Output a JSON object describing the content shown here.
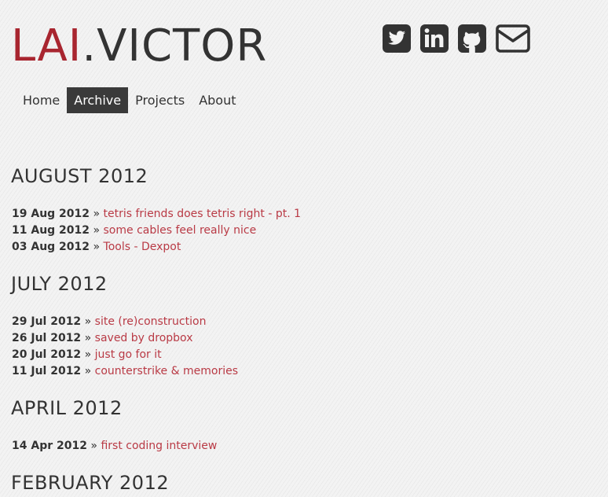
{
  "header": {
    "logo_first": "LAI",
    "logo_rest": ".VICTOR"
  },
  "social": [
    {
      "name": "twitter-icon"
    },
    {
      "name": "linkedin-icon"
    },
    {
      "name": "github-icon"
    },
    {
      "name": "mail-icon"
    }
  ],
  "colors": {
    "accent": "#a8252f",
    "link": "#b93a45",
    "text": "#333333",
    "nav_active_bg": "#3a3a3a"
  },
  "nav": {
    "items": [
      {
        "label": "Home",
        "active": false
      },
      {
        "label": "Archive",
        "active": true
      },
      {
        "label": "Projects",
        "active": false
      },
      {
        "label": "About",
        "active": false
      }
    ]
  },
  "separator": "»",
  "archive": [
    {
      "month": "AUGUST 2012",
      "posts": [
        {
          "date": "19 Aug 2012",
          "title": "tetris friends does tetris right - pt. 1"
        },
        {
          "date": "11 Aug 2012",
          "title": "some cables feel really nice"
        },
        {
          "date": "03 Aug 2012",
          "title": "Tools - Dexpot"
        }
      ]
    },
    {
      "month": "JULY 2012",
      "posts": [
        {
          "date": "29 Jul 2012",
          "title": "site (re)construction"
        },
        {
          "date": "26 Jul 2012",
          "title": "saved by dropbox"
        },
        {
          "date": "20 Jul 2012",
          "title": "just go for it"
        },
        {
          "date": "11 Jul 2012",
          "title": "counterstrike & memories"
        }
      ]
    },
    {
      "month": "APRIL 2012",
      "posts": [
        {
          "date": "14 Apr 2012",
          "title": "first coding interview"
        }
      ]
    },
    {
      "month": "FEBRUARY 2012",
      "posts": []
    }
  ]
}
